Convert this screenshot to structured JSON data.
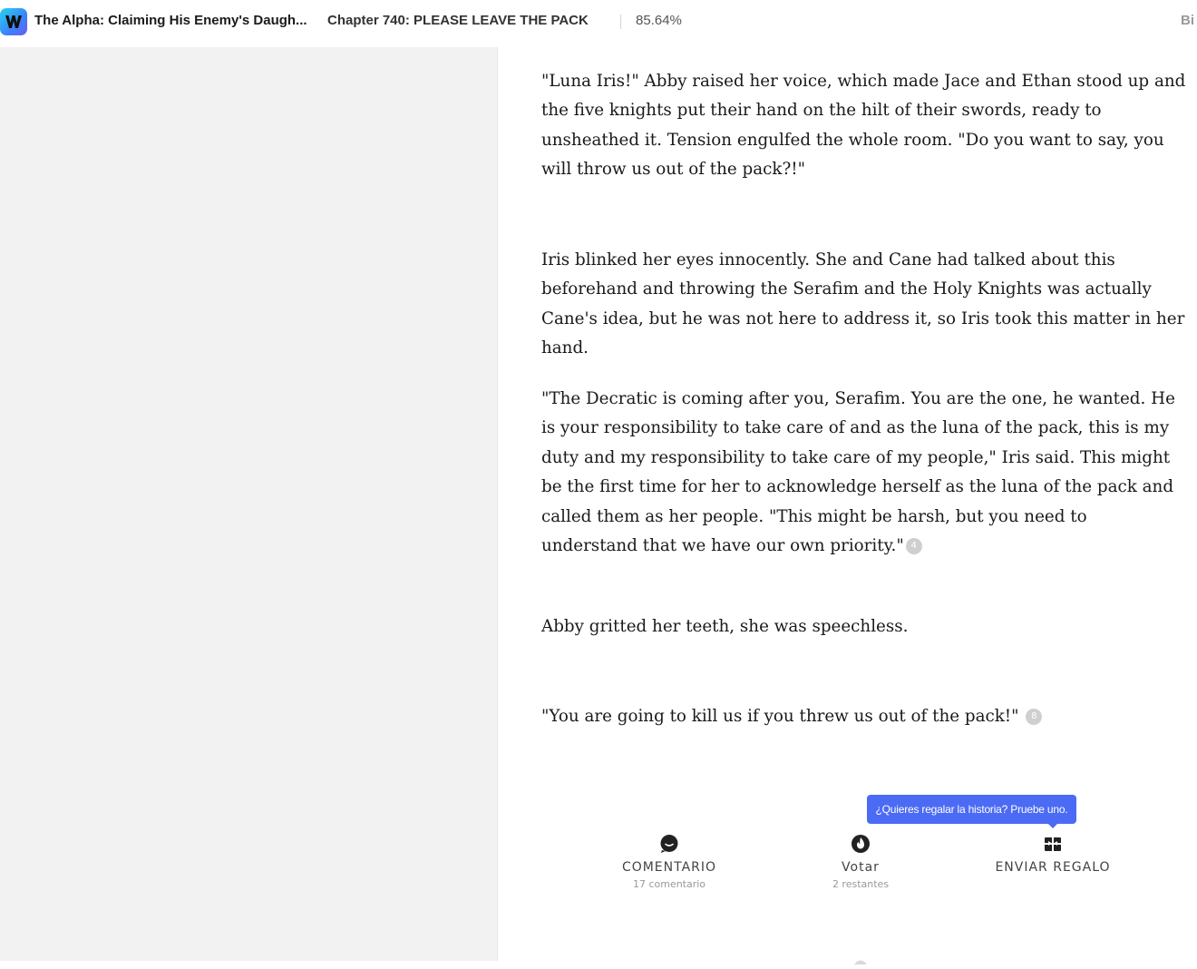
{
  "header": {
    "logo_letter": "W",
    "book_title": "The Alpha: Claiming His Enemy's Daugh...",
    "chapter_title": "Chapter 740: PLEASE LEAVE THE PACK",
    "progress": "85.64%",
    "right_button": "Bi"
  },
  "paragraphs": [
    {
      "text": "\"Luna Iris!\" Abby raised her voice, which made Jace and Ethan stood up and the five knights put their hand on the hilt of their swords, ready to unsheathed it. Tension engulfed the whole room. \"Do you want to say, you will throw us out of the pack?!\"",
      "comments": ""
    },
    {
      "text": "Iris blinked her eyes innocently. She and Cane had talked about this beforehand and throwing the Serafim and the Holy Knights was actually Cane's idea, but he was not here to address it, so Iris took this matter in her hand.",
      "comments": ""
    },
    {
      "text": "\"The Decratic is coming after you, Serafim. You are the one, he wanted. He is your responsibility to take care of and as the luna of the pack, this is my duty and my responsibility to take care of my people,\" Iris said. This might be the first time for her to acknowledge herself as the luna of the pack and called them as her people. \"This might be harsh, but you need to understand that we have our own priority.\"",
      "comments": "4"
    },
    {
      "text": "Abby gritted her teeth, she was speechless.",
      "comments": ""
    },
    {
      "text": "\"You are going to kill us if you threw us out of the pack!\"",
      "comments": "8"
    }
  ],
  "tooltip": "¿Quieres regalar la historia? Pruebe uno.",
  "actions": {
    "comment": {
      "icon": "comment-bubble-icon",
      "label": "COMENTARIO",
      "sub": "17 comentario"
    },
    "vote": {
      "icon": "flame-icon",
      "label": "Votar",
      "sub": "2 restantes"
    },
    "gift": {
      "icon": "gift-icon",
      "label": "ENVIAR REGALO",
      "sub": ""
    }
  },
  "colors": {
    "accent": "#4b6bf5",
    "left_panel": "#f2f2f2",
    "badge": "#cfcfcf"
  }
}
